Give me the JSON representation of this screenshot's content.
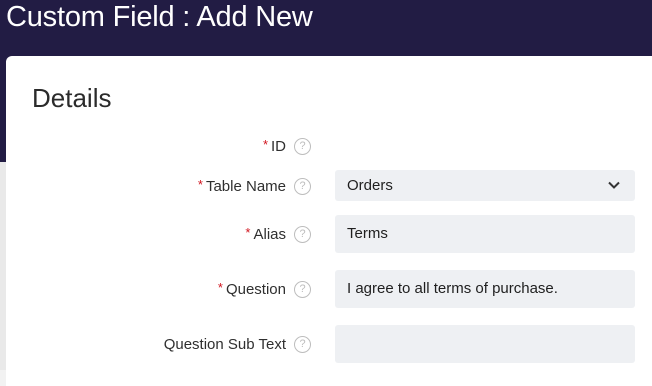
{
  "header": {
    "title": "Custom Field : Add New"
  },
  "section": {
    "title": "Details"
  },
  "fields": [
    {
      "label": "ID",
      "required": "*",
      "value": ""
    },
    {
      "label": "Table Name",
      "required": "*",
      "value": "Orders"
    },
    {
      "label": "Alias",
      "required": "*",
      "value": "Terms"
    },
    {
      "label": "Question",
      "required": "*",
      "value": "I agree to all terms of purchase."
    },
    {
      "label": "Question Sub Text",
      "required": "",
      "value": ""
    }
  ],
  "icons": {
    "help": "help-circle-icon",
    "dropdown": "chevron-down-icon"
  },
  "colors": {
    "header_bg": "#221c44",
    "required": "#d1131d",
    "field_bg": "#eef0f3"
  }
}
